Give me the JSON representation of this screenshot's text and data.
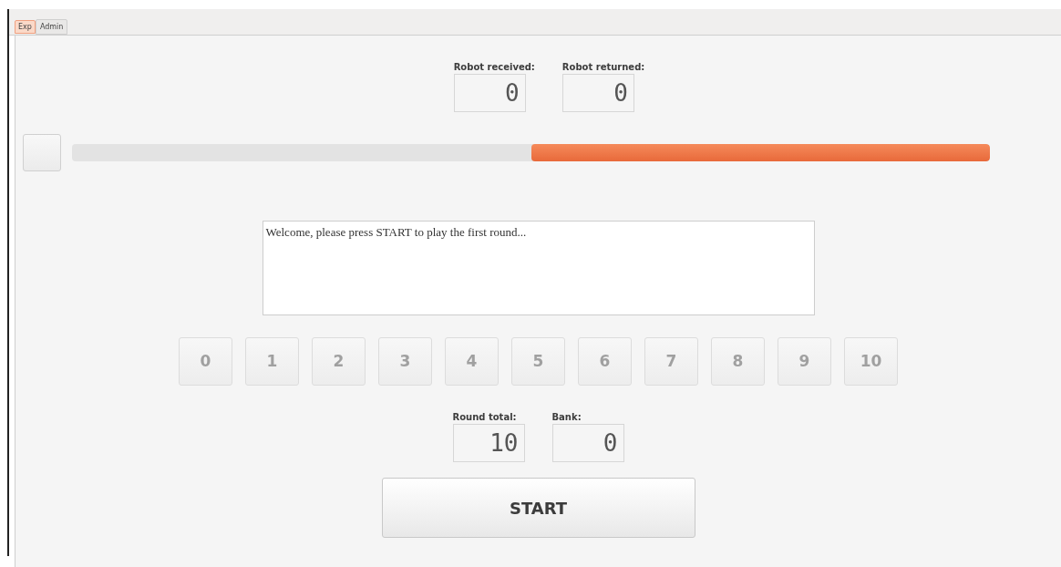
{
  "tabs": [
    {
      "label": "Exp",
      "selected": true
    },
    {
      "label": "Admin",
      "selected": false
    }
  ],
  "top_displays": [
    {
      "label": "Robot received:",
      "value": "0"
    },
    {
      "label": "Robot returned:",
      "value": "0"
    }
  ],
  "progress": {
    "level": 0.5
  },
  "message": "Welcome, please press START to play the first round...",
  "choice_buttons": [
    {
      "label": "0",
      "disabled": true
    },
    {
      "label": "1",
      "disabled": true
    },
    {
      "label": "2",
      "disabled": true
    },
    {
      "label": "3",
      "disabled": true
    },
    {
      "label": "4",
      "disabled": true
    },
    {
      "label": "5",
      "disabled": true
    },
    {
      "label": "6",
      "disabled": true
    },
    {
      "label": "7",
      "disabled": true
    },
    {
      "label": "8",
      "disabled": true
    },
    {
      "label": "9",
      "disabled": true
    },
    {
      "label": "10",
      "disabled": true
    }
  ],
  "bottom_displays": [
    {
      "label": "Round total:",
      "value": "10"
    },
    {
      "label": "Bank:",
      "value": "0"
    }
  ],
  "start_button": "START"
}
